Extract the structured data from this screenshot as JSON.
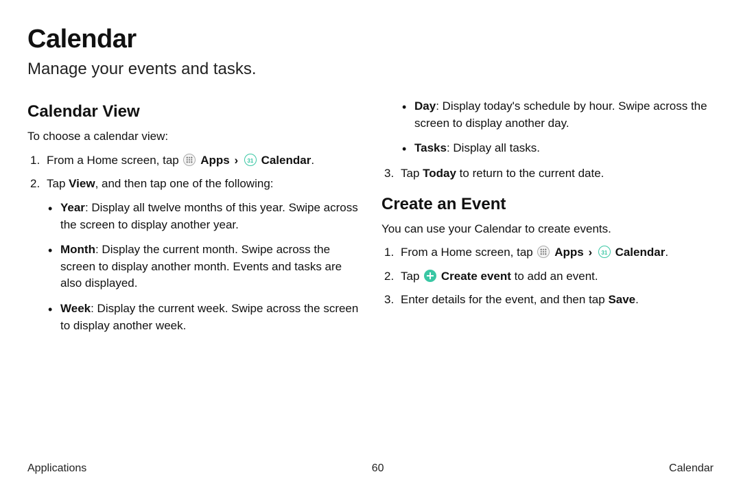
{
  "title": "Calendar",
  "subtitle": "Manage your events and tasks.",
  "left": {
    "heading": "Calendar View",
    "intro": "To choose a calendar view:",
    "step1_pre": "From a Home screen, tap ",
    "apps_label": "Apps",
    "calendar_label": "Calendar",
    "step1_post": ".",
    "step2_pre": "Tap ",
    "view_label": "View",
    "step2_post": ", and then tap one of the following:",
    "bullets": [
      {
        "term": "Year",
        "desc": ": Display all twelve months of this year. Swipe across the screen to display another year."
      },
      {
        "term": "Month",
        "desc": ": Display the current month. Swipe across the screen to display another month. Events and tasks are also displayed."
      },
      {
        "term": "Week",
        "desc": ": Display the current week. Swipe across the screen to display another week."
      }
    ]
  },
  "right": {
    "top_bullets": [
      {
        "term": "Day",
        "desc": ": Display today's schedule by hour. Swipe across the screen to display another day."
      },
      {
        "term": "Tasks",
        "desc": ": Display all tasks."
      }
    ],
    "step3_pre": "Tap ",
    "today_label": "Today",
    "step3_post": " to return to the current date.",
    "heading2": "Create an Event",
    "intro2": "You can use your Calendar to create events.",
    "ev_step1_pre": "From a Home screen, tap ",
    "ev_step2_pre": "Tap ",
    "create_event_label": "Create event",
    "ev_step2_post": " to add an event.",
    "ev_step3_pre": "Enter details for the event, and then tap ",
    "save_label": "Save",
    "ev_step3_post": "."
  },
  "footer": {
    "left": "Applications",
    "center": "60",
    "right": "Calendar"
  }
}
